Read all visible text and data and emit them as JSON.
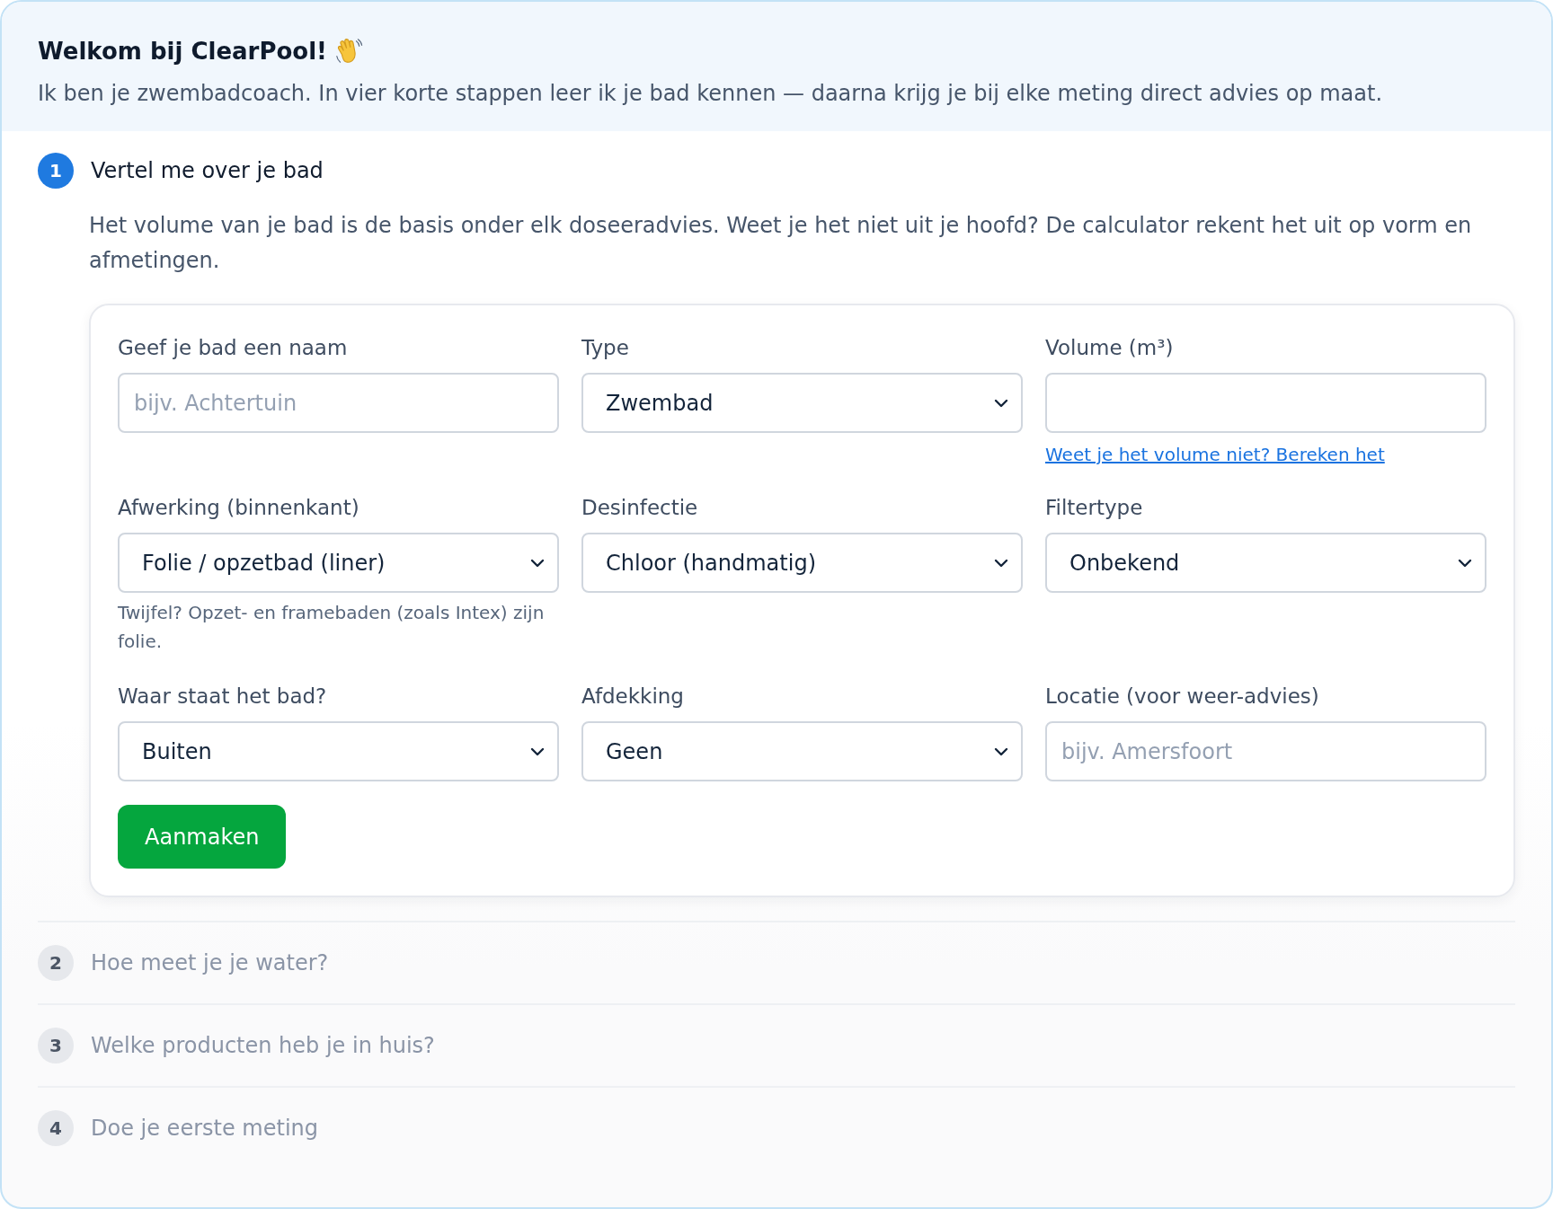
{
  "header": {
    "title": "Welkom bij ClearPool!",
    "intro": "Ik ben je zwembadcoach. In vier korte stappen leer ik je bad kennen — daarna krijg je bij elke meting direct advies op maat."
  },
  "steps": [
    {
      "number": "1",
      "title": "Vertel me over je bad",
      "active": true,
      "description": "Het volume van je bad is de basis onder elk doseeradvies. Weet je het niet uit je hoofd? De calculator rekent het uit op vorm en afmetingen.",
      "form": {
        "fields": [
          {
            "kind": "input",
            "label": "Geef je bad een naam",
            "placeholder": "bijv. Achtertuin"
          },
          {
            "kind": "select",
            "label": "Type",
            "value": "Zwembad"
          },
          {
            "kind": "input",
            "label": "Volume (m³)",
            "link": "Weet je het volume niet? Bereken het"
          },
          {
            "kind": "select",
            "label": "Afwerking (binnenkant)",
            "value": "Folie / opzetbad (liner)",
            "hint": "Twijfel? Opzet- en framebaden (zoals Intex) zijn folie."
          },
          {
            "kind": "select",
            "label": "Desinfectie",
            "value": "Chloor (handmatig)"
          },
          {
            "kind": "select",
            "label": "Filtertype",
            "value": "Onbekend"
          },
          {
            "kind": "select",
            "label": "Waar staat het bad?",
            "value": "Buiten"
          },
          {
            "kind": "select",
            "label": "Afdekking",
            "value": "Geen"
          },
          {
            "kind": "input",
            "label": "Locatie (voor weer-advies)",
            "placeholder": "bijv. Amersfoort"
          }
        ],
        "submit": "Aanmaken"
      }
    },
    {
      "number": "2",
      "title": "Hoe meet je je water?",
      "active": false
    },
    {
      "number": "3",
      "title": "Welke producten heb je in huis?",
      "active": false
    },
    {
      "number": "4",
      "title": "Doe je eerste meting",
      "active": false
    }
  ]
}
